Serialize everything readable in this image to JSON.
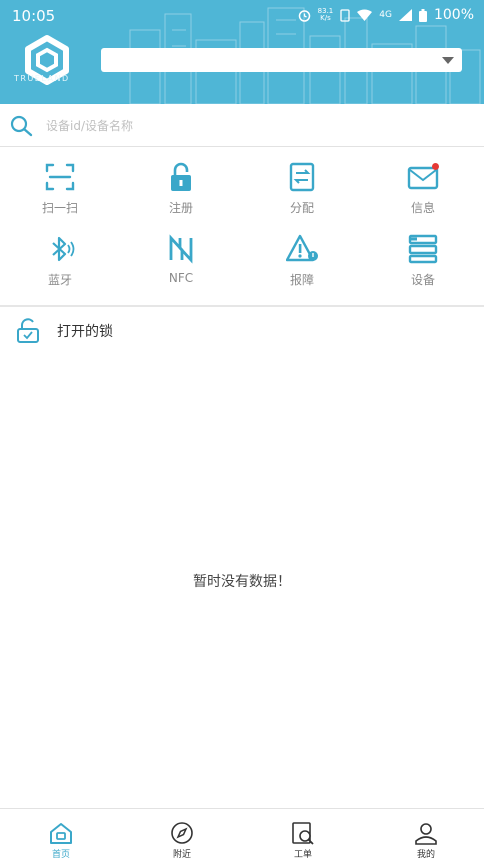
{
  "status": {
    "time": "10:05",
    "speed": "83.1",
    "speed_unit": "K/s",
    "network": "4G",
    "battery": "100%"
  },
  "brand": {
    "logo_text": "TRUELAND"
  },
  "selector": {
    "value": ""
  },
  "search": {
    "placeholder": "设备id/设备名称"
  },
  "functions": [
    {
      "label": "扫一扫",
      "icon": "scan-icon"
    },
    {
      "label": "注册",
      "icon": "lock-icon"
    },
    {
      "label": "分配",
      "icon": "transfer-icon"
    },
    {
      "label": "信息",
      "icon": "message-icon",
      "badge": true
    },
    {
      "label": "蓝牙",
      "icon": "bluetooth-icon"
    },
    {
      "label": "NFC",
      "icon": "nfc-icon"
    },
    {
      "label": "报障",
      "icon": "warning-icon"
    },
    {
      "label": "设备",
      "icon": "device-icon"
    }
  ],
  "section": {
    "title": "打开的锁"
  },
  "empty_text": "暂时没有数据！",
  "tabs": [
    {
      "label": "首页",
      "icon": "home-icon",
      "active": true
    },
    {
      "label": "附近",
      "icon": "compass-icon"
    },
    {
      "label": "工单",
      "icon": "workorder-icon"
    },
    {
      "label": "我的",
      "icon": "profile-icon"
    }
  ],
  "colors": {
    "header": "#4fb6d6",
    "accent": "#3aa7c9",
    "active_tab": "#3aa7c9",
    "badge": "#e53935"
  }
}
